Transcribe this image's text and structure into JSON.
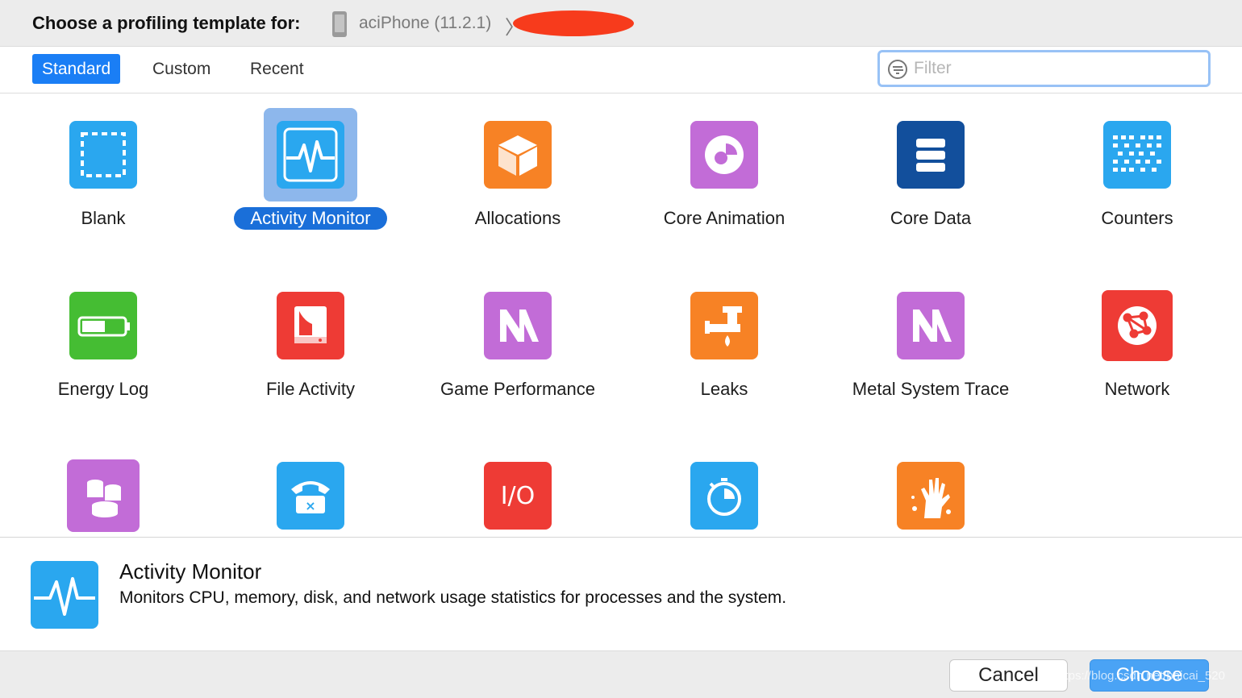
{
  "header": {
    "title": "Choose a profiling template for:",
    "device_name": "aciPhone (11.2.1)",
    "chevron": "〉"
  },
  "tabs": [
    {
      "label": "Standard",
      "active": true
    },
    {
      "label": "Custom",
      "active": false
    },
    {
      "label": "Recent",
      "active": false
    }
  ],
  "filter": {
    "placeholder": "Filter",
    "value": ""
  },
  "templates": [
    {
      "label": "Blank",
      "icon": "blank-icon",
      "color": "#2aa7ef",
      "selected": false
    },
    {
      "label": "Activity Monitor",
      "icon": "activity-monitor-icon",
      "color": "#2aa7ef",
      "selected": true
    },
    {
      "label": "Allocations",
      "icon": "allocations-icon",
      "color": "#f78225",
      "selected": false
    },
    {
      "label": "Core Animation",
      "icon": "core-animation-icon",
      "color": "#c26cd7",
      "selected": false
    },
    {
      "label": "Core Data",
      "icon": "core-data-icon",
      "color": "#124f9c",
      "selected": false
    },
    {
      "label": "Counters",
      "icon": "counters-icon",
      "color": "#2aa7ef",
      "selected": false
    },
    {
      "label": "Energy Log",
      "icon": "energy-log-icon",
      "color": "#45bd33",
      "selected": false
    },
    {
      "label": "File Activity",
      "icon": "file-activity-icon",
      "color": "#ee3b35",
      "selected": false
    },
    {
      "label": "Game Performance",
      "icon": "game-performance-icon",
      "color": "#c26cd7",
      "selected": false
    },
    {
      "label": "Leaks",
      "icon": "leaks-icon",
      "color": "#f78225",
      "selected": false
    },
    {
      "label": "Metal System Trace",
      "icon": "metal-system-trace-icon",
      "color": "#c26cd7",
      "selected": false
    },
    {
      "label": "Network",
      "icon": "network-icon",
      "color": "#ee3b35",
      "selected": false
    },
    {
      "label": "",
      "icon": "sqlite-icon",
      "color": "#c26cd7",
      "selected": false
    },
    {
      "label": "",
      "icon": "system-trace-icon",
      "color": "#2aa7ef",
      "selected": false
    },
    {
      "label": "",
      "icon": "io-icon",
      "color": "#ee3b35",
      "selected": false,
      "glyph": "I/O"
    },
    {
      "label": "",
      "icon": "time-profiler-icon",
      "color": "#2aa7ef",
      "selected": false
    },
    {
      "label": "",
      "icon": "zombies-icon",
      "color": "#f78225",
      "selected": false
    }
  ],
  "description": {
    "title": "Activity Monitor",
    "text": "Monitors CPU, memory, disk, and network usage statistics for processes and the system."
  },
  "buttons": {
    "cancel": "Cancel",
    "choose": "Choose"
  },
  "watermark": "https://blog.csdn.net/baicai_520",
  "colors": {
    "accent": "#1a7ef5",
    "selection": "#1a6fd9",
    "redaction": "#f73b1c"
  }
}
